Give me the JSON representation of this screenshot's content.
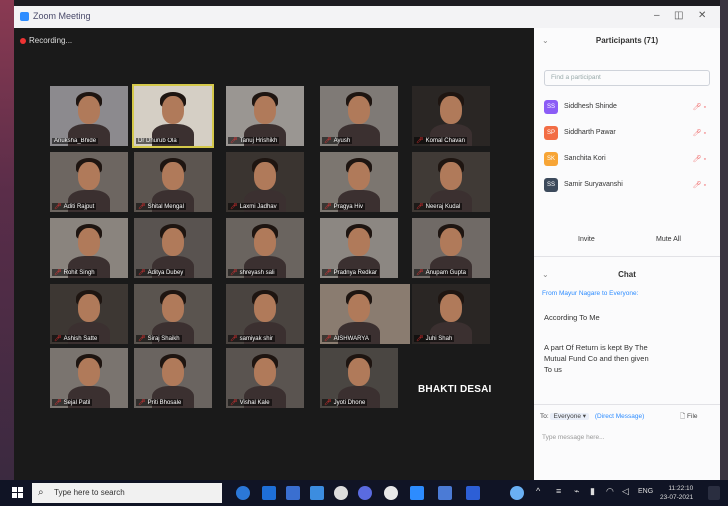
{
  "window": {
    "title": "Zoom Meeting",
    "controls": [
      "–",
      "◫",
      "✕"
    ]
  },
  "recording": {
    "label": "Recording..."
  },
  "gallery": {
    "tiles": [
      {
        "name": "Anuksha_Bhide",
        "muted": false
      },
      {
        "name": "Dr Dhurub Ola",
        "muted": false,
        "active": true
      },
      {
        "name": "Tanuj Hrishikh",
        "muted": true
      },
      {
        "name": "Ayush",
        "muted": true
      },
      {
        "name": "Komal Chavan",
        "muted": true
      },
      {
        "name": "Aditi Rajput",
        "muted": true
      },
      {
        "name": "Shital Mengal",
        "muted": true
      },
      {
        "name": "Laxmi Jadhav",
        "muted": true
      },
      {
        "name": "Pragya Hiv",
        "muted": true
      },
      {
        "name": "Neeraj Kudal",
        "muted": true
      },
      {
        "name": "Rohit Singh",
        "muted": true
      },
      {
        "name": "Aditya Dubey",
        "muted": true
      },
      {
        "name": "shreyash sali",
        "muted": true
      },
      {
        "name": "Pradnya Redkar",
        "muted": true
      },
      {
        "name": "Anupam Gupta",
        "muted": true
      },
      {
        "name": "Ashish Satte",
        "muted": true
      },
      {
        "name": "Siraj Shaikh",
        "muted": true
      },
      {
        "name": "samiyak shir",
        "muted": true
      },
      {
        "name": "AISHWARYA",
        "muted": true
      },
      {
        "name": "Juhi Shah",
        "muted": true
      },
      {
        "name": "Sejal Patil",
        "muted": true
      },
      {
        "name": "Priti Bhosale",
        "muted": true
      },
      {
        "name": "Vishal Kale",
        "muted": true
      },
      {
        "name": "Jyoti Dhone",
        "muted": true
      }
    ],
    "name_card": "BHAKTI DESAI"
  },
  "participants": {
    "header": "Participants (71)",
    "search_placeholder": "Find a participant",
    "list": [
      {
        "initials": "SS",
        "name": "Siddhesh Shinde",
        "color": "#8b5cf6"
      },
      {
        "initials": "SP",
        "name": "Siddharth Pawar",
        "color": "#f26d45"
      },
      {
        "initials": "SK",
        "name": "Sanchita Kori",
        "color": "#f7a536"
      },
      {
        "initials": "SS",
        "name": "Samir Suryavanshi",
        "color": "#3c4a5c"
      }
    ],
    "invite_label": "Invite",
    "mute_all_label": "Mute All"
  },
  "chat": {
    "header": "Chat",
    "from": "From Mayur Nagare to Everyone:",
    "messages": [
      "According To Me",
      "A part Of Return is kept By The Mutual Fund Co and then given To us"
    ],
    "to_label": "To:",
    "to_value": "Everyone ▾",
    "dm_label": "(Direct Message)",
    "file_label": "File",
    "input_placeholder": "Type message here..."
  },
  "taskbar": {
    "search_placeholder": "Type here to search",
    "tray_lang": "ENG",
    "time": "11:22:10",
    "date": "23-07-2021"
  }
}
